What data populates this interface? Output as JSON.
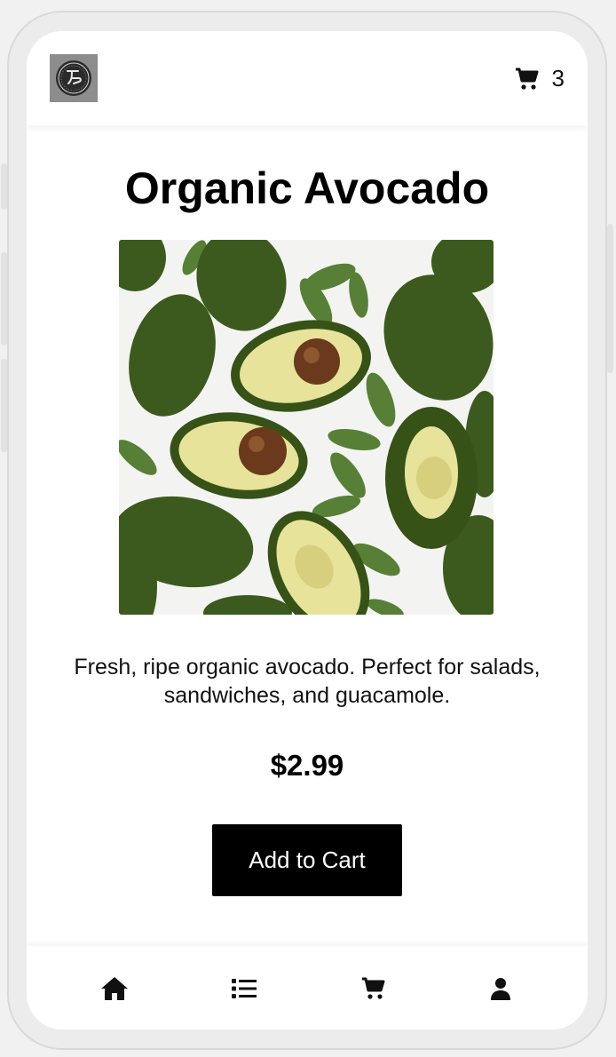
{
  "header": {
    "logo_alt": "store logo",
    "cart_count": "3"
  },
  "product": {
    "title": "Organic Avocado",
    "description": "Fresh, ripe organic avocado. Perfect for salads, sandwiches, and guacamole.",
    "price": "$2.99",
    "add_to_cart_label": "Add to Cart"
  },
  "bottom_nav": {
    "items": [
      {
        "icon": "home-icon"
      },
      {
        "icon": "list-icon"
      },
      {
        "icon": "cart-icon"
      },
      {
        "icon": "user-icon"
      }
    ]
  },
  "colors": {
    "button_bg": "#000000",
    "button_text": "#ffffff",
    "avocado_skin": "#3f5d1f",
    "avocado_flesh": "#e7e39a",
    "pit": "#6b3a1c"
  }
}
